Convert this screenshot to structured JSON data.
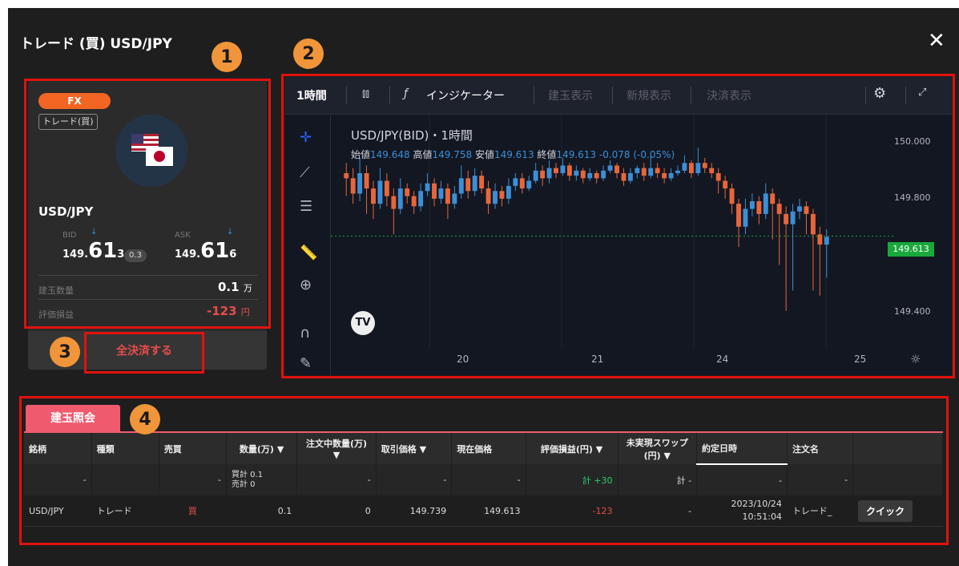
{
  "window": {
    "title": "トレード (買) USD/JPY",
    "close_icon": "close-icon"
  },
  "markers": [
    "1",
    "2",
    "3",
    "4"
  ],
  "position_card": {
    "product_badge": "FX",
    "trade_tag": "トレード(買)",
    "symbol": "USD/JPY",
    "bid_label": "BID",
    "ask_label": "ASK",
    "bid_pre": "149.",
    "bid_main": "61",
    "bid_post": "3",
    "ask_pre": "149.",
    "ask_main": "61",
    "ask_post": "6",
    "spread": "0.3",
    "qty_label": "建玉数量",
    "qty_value": "0.1",
    "qty_unit": "万",
    "pl_label": "評価損益",
    "pl_value": "-123",
    "pl_unit": "円",
    "close_all_button": "全決済する"
  },
  "chart_toolbar": {
    "interval": "1時間",
    "indicator": "インジケーター",
    "position_display": "建玉表示",
    "new_display": "新規表示",
    "settle_display": "決済表示"
  },
  "chart_data": {
    "type": "candlestick",
    "title": "USD/JPY(BID)・1時間",
    "ohlc_labels": {
      "open": "始値",
      "high": "高値",
      "low": "安値",
      "close": "終値"
    },
    "ohlc_values": {
      "open": "149.648",
      "high": "149.758",
      "low": "149.613",
      "close": "149.613",
      "change": "-0.078 (-0.05%)"
    },
    "y_ticks": [
      "150.000",
      "149.800",
      "149.400"
    ],
    "current_price": "149.613",
    "x_ticks": [
      "20",
      "21",
      "24",
      "25"
    ],
    "ylim": [
      149.2,
      150.08
    ],
    "colors": {
      "up": "#3b8fd6",
      "down": "#e8663a"
    },
    "candles": [
      [
        149.86,
        149.84,
        149.9,
        149.77
      ],
      [
        149.84,
        149.78,
        149.88,
        149.74
      ],
      [
        149.78,
        149.86,
        149.92,
        149.75
      ],
      [
        149.86,
        149.8,
        149.89,
        149.7
      ],
      [
        149.8,
        149.74,
        149.83,
        149.68
      ],
      [
        149.74,
        149.83,
        149.88,
        149.72
      ],
      [
        149.83,
        149.77,
        149.86,
        149.73
      ],
      [
        149.77,
        149.72,
        149.8,
        149.62
      ],
      [
        149.72,
        149.8,
        149.84,
        149.7
      ],
      [
        149.8,
        149.77,
        149.82,
        149.74
      ],
      [
        149.77,
        149.73,
        149.79,
        149.7
      ],
      [
        149.73,
        149.79,
        149.82,
        149.71
      ],
      [
        149.79,
        149.82,
        149.86,
        149.77
      ],
      [
        149.82,
        149.76,
        149.84,
        149.73
      ],
      [
        149.76,
        149.8,
        149.83,
        149.74
      ],
      [
        149.8,
        149.74,
        149.82,
        149.68
      ],
      [
        149.74,
        149.78,
        149.81,
        149.72
      ],
      [
        149.78,
        149.84,
        149.89,
        149.76
      ],
      [
        149.84,
        149.79,
        149.87,
        149.76
      ],
      [
        149.79,
        149.85,
        149.88,
        149.77
      ],
      [
        149.85,
        149.8,
        149.87,
        149.78
      ],
      [
        149.8,
        149.74,
        149.83,
        149.7
      ],
      [
        149.74,
        149.79,
        149.82,
        149.72
      ],
      [
        149.79,
        149.76,
        149.81,
        149.73
      ],
      [
        149.76,
        149.81,
        149.84,
        149.74
      ],
      [
        149.81,
        149.84,
        149.86,
        149.79
      ],
      [
        149.84,
        149.8,
        149.86,
        149.78
      ],
      [
        149.8,
        149.83,
        149.85,
        149.79
      ],
      [
        149.83,
        149.87,
        149.9,
        149.82
      ],
      [
        149.87,
        149.84,
        149.89,
        149.81
      ],
      [
        149.84,
        149.88,
        149.91,
        149.82
      ],
      [
        149.88,
        149.86,
        149.9,
        149.84
      ],
      [
        149.86,
        149.89,
        149.92,
        149.85
      ],
      [
        149.89,
        149.85,
        149.9,
        149.83
      ],
      [
        149.85,
        149.87,
        149.89,
        149.83
      ],
      [
        149.87,
        149.84,
        149.88,
        149.82
      ],
      [
        149.84,
        149.86,
        149.88,
        149.83
      ],
      [
        149.86,
        149.84,
        149.87,
        149.82
      ],
      [
        149.84,
        149.87,
        149.89,
        149.83
      ],
      [
        149.87,
        149.89,
        149.91,
        149.86
      ],
      [
        149.89,
        149.86,
        149.9,
        149.84
      ],
      [
        149.86,
        149.83,
        149.88,
        149.81
      ],
      [
        149.83,
        149.86,
        149.88,
        149.82
      ],
      [
        149.86,
        149.88,
        149.89,
        149.84
      ],
      [
        149.88,
        149.85,
        149.9,
        149.83
      ],
      [
        149.85,
        149.88,
        149.93,
        149.84
      ],
      [
        149.88,
        149.86,
        149.9,
        149.84
      ],
      [
        149.86,
        149.84,
        149.88,
        149.82
      ],
      [
        149.84,
        149.86,
        149.88,
        149.83
      ],
      [
        149.86,
        149.87,
        149.89,
        149.85
      ],
      [
        149.87,
        149.9,
        149.93,
        149.86
      ],
      [
        149.9,
        149.86,
        149.91,
        149.84
      ],
      [
        149.86,
        149.9,
        149.96,
        149.85
      ],
      [
        149.9,
        149.88,
        149.92,
        149.86
      ],
      [
        149.88,
        149.86,
        149.9,
        149.84
      ],
      [
        149.86,
        149.83,
        149.88,
        149.78
      ],
      [
        149.83,
        149.8,
        149.85,
        149.76
      ],
      [
        149.8,
        149.74,
        149.82,
        149.7
      ],
      [
        149.74,
        149.65,
        149.76,
        149.57
      ],
      [
        149.65,
        149.72,
        149.76,
        149.62
      ],
      [
        149.72,
        149.75,
        149.78,
        149.69
      ],
      [
        149.75,
        149.7,
        149.77,
        149.66
      ],
      [
        149.7,
        149.78,
        149.82,
        149.68
      ],
      [
        149.78,
        149.74,
        149.8,
        149.6
      ],
      [
        149.74,
        149.7,
        149.76,
        149.5
      ],
      [
        149.7,
        149.66,
        149.73,
        149.32
      ],
      [
        149.66,
        149.71,
        149.74,
        149.4
      ],
      [
        149.71,
        149.73,
        149.76,
        149.68
      ],
      [
        149.73,
        149.7,
        149.75,
        149.62
      ],
      [
        149.7,
        149.62,
        149.72,
        149.4
      ],
      [
        149.62,
        149.58,
        149.65,
        149.38
      ],
      [
        149.58,
        149.61,
        149.64,
        149.45
      ]
    ]
  },
  "positions_tab": "建玉照会",
  "table": {
    "headers": [
      "銘柄",
      "種類",
      "売買",
      "数量(万)",
      "注文中数量(万)",
      "取引価格",
      "現在価格",
      "評価損益(円)",
      "未実現スワップ(円)",
      "約定日時",
      "注文名",
      ""
    ],
    "summary": {
      "c0": "-",
      "c1": "",
      "c2": "-",
      "buy": "買計 0.1",
      "sell": "売計 0",
      "c4": "-",
      "c5": "-",
      "c6": "-",
      "pl": "計 +30",
      "swap": "計 -",
      "c9": "-",
      "c10": "-"
    },
    "rows": [
      {
        "symbol": "USD/JPY",
        "type": "トレード",
        "side": "買",
        "qty": "0.1",
        "pending": "0",
        "entry": "149.739",
        "current": "149.613",
        "pl": "-123",
        "swap": "-",
        "date": "2023/10/24",
        "time": "10:51:04",
        "order": "トレード_",
        "button": "クイック"
      }
    ]
  }
}
